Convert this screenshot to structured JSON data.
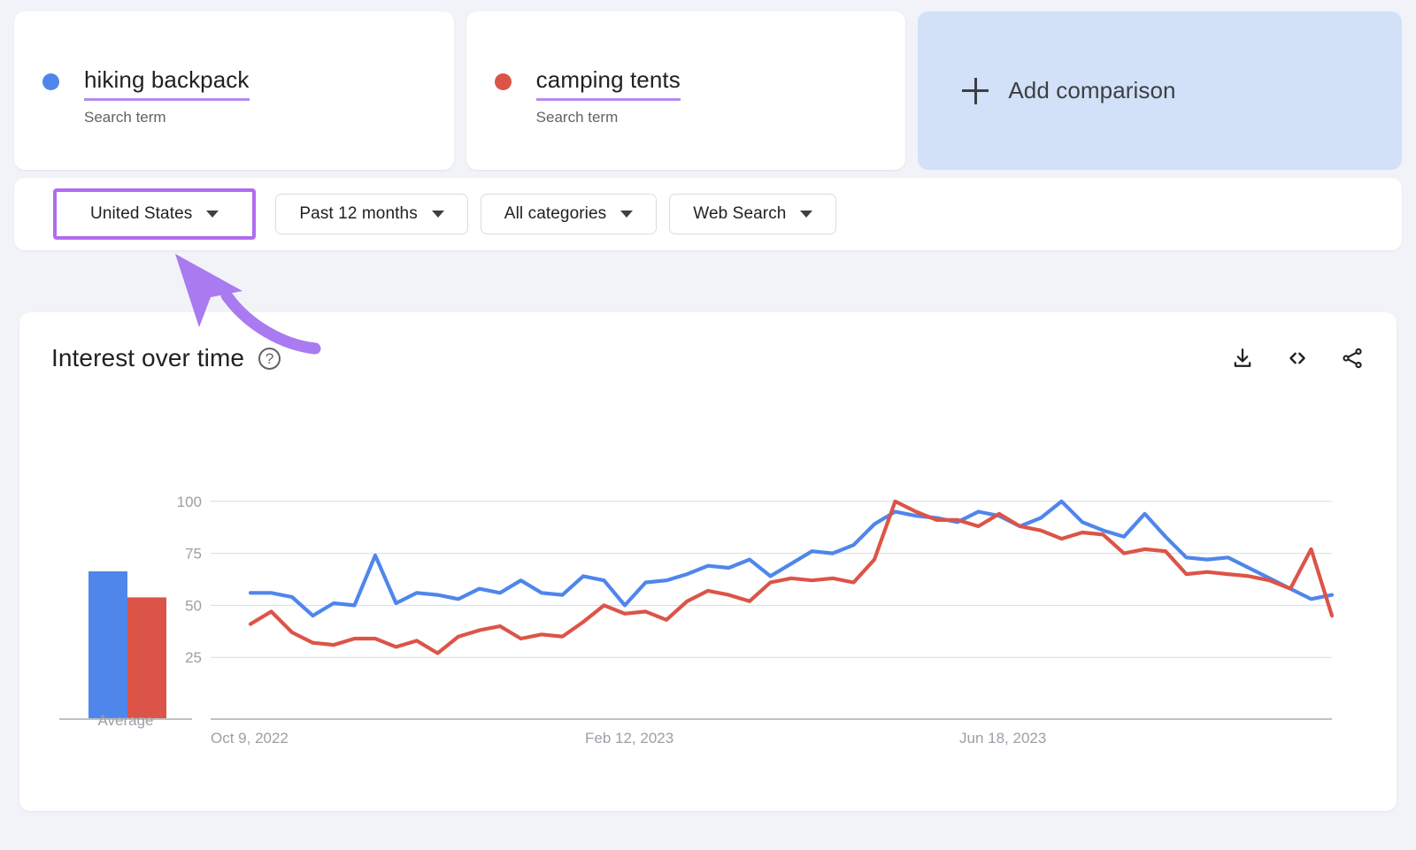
{
  "terms": [
    {
      "label": "hiking backpack",
      "sublabel": "Search term",
      "color": "#4f86ec",
      "dot": "series-dot-blue"
    },
    {
      "label": "camping tents",
      "sublabel": "Search term",
      "color": "#dc5448",
      "dot": "series-dot-red"
    }
  ],
  "add_comparison": {
    "label": "Add comparison",
    "icon": "plus-icon"
  },
  "filters": [
    {
      "label": "United States",
      "highlighted": true
    },
    {
      "label": "Past 12 months",
      "highlighted": false
    },
    {
      "label": "All categories",
      "highlighted": false
    },
    {
      "label": "Web Search",
      "highlighted": false
    }
  ],
  "panel": {
    "title": "Interest over time",
    "help_icon": "?",
    "actions": [
      {
        "name": "download-icon",
        "tip": "Download"
      },
      {
        "name": "embed-icon",
        "tip": "Embed"
      },
      {
        "name": "share-icon",
        "tip": "Share"
      }
    ]
  },
  "annotation": {
    "type": "arrow",
    "color": "#a97af0",
    "points_to": "United States"
  },
  "chart_data": {
    "type": "line",
    "title": "Interest over time",
    "xlabel": "",
    "ylabel": "",
    "ylim": [
      0,
      105
    ],
    "yticks": [
      25,
      50,
      75,
      100
    ],
    "grid": true,
    "legend_position": "top-cards",
    "xticks": [
      "Oct 9, 2022",
      "Feb 12, 2023",
      "Jun 18, 2023"
    ],
    "xtick_index": [
      0,
      18,
      36
    ],
    "x_count": 53,
    "series": [
      {
        "name": "hiking backpack",
        "color": "#4f86ec",
        "values": [
          56,
          56,
          54,
          45,
          51,
          50,
          74,
          51,
          56,
          55,
          53,
          58,
          56,
          62,
          56,
          55,
          64,
          62,
          50,
          61,
          62,
          65,
          69,
          68,
          72,
          64,
          70,
          76,
          75,
          79,
          89,
          95,
          93,
          92,
          90,
          95,
          93,
          88,
          92,
          100,
          90,
          86,
          83,
          94,
          83,
          73,
          72,
          73,
          68,
          63,
          58,
          53,
          55
        ]
      },
      {
        "name": "camping tents",
        "color": "#dc5448",
        "values": [
          41,
          47,
          37,
          32,
          31,
          34,
          34,
          30,
          33,
          27,
          35,
          38,
          40,
          34,
          36,
          35,
          42,
          50,
          46,
          47,
          43,
          52,
          57,
          55,
          52,
          61,
          63,
          62,
          63,
          61,
          72,
          100,
          95,
          91,
          91,
          88,
          94,
          88,
          86,
          82,
          85,
          84,
          75,
          77,
          76,
          65,
          66,
          65,
          64,
          62,
          58,
          77,
          45
        ]
      }
    ],
    "average": {
      "label": "Average",
      "bars": [
        {
          "name": "hiking backpack",
          "value": 68,
          "color": "#4f86ec"
        },
        {
          "name": "camping tents",
          "value": 56,
          "color": "#dc5448"
        }
      ]
    }
  }
}
